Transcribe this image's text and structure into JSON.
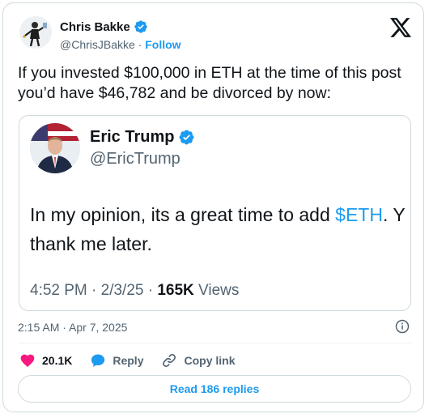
{
  "author": {
    "name": "Chris Bakke",
    "handle": "@ChrisJBakke",
    "separator": "·",
    "follow_label": "Follow"
  },
  "tweet": {
    "text": "If you invested $100,000 in ETH at the time of this post you’d have $46,782 and be divorced by now:",
    "timestamp": "2:15 AM · Apr 7, 2025"
  },
  "quoted": {
    "name": "Eric Trump",
    "handle": "@EricTrump",
    "text_before": "In my opinion, its a great time to add ",
    "cashtag": "$ETH",
    "text_after_line1": ". Y",
    "text_line2": "thank me later.",
    "meta_prefix": "4:52 PM · 2/3/25 · ",
    "views_count": "165K",
    "views_label": " Views"
  },
  "actions": {
    "like_count": "20.1K",
    "reply_label": "Reply",
    "copy_label": "Copy link"
  },
  "read_replies_label": "Read 186 replies",
  "colors": {
    "accent": "#1d9bf0",
    "like": "#f91880",
    "text": "#0f1419",
    "muted": "#536471",
    "border": "#cfd9de"
  },
  "icons": [
    "verified-badge-icon",
    "x-logo-icon",
    "info-icon",
    "heart-icon",
    "reply-bubble-icon",
    "link-icon"
  ]
}
